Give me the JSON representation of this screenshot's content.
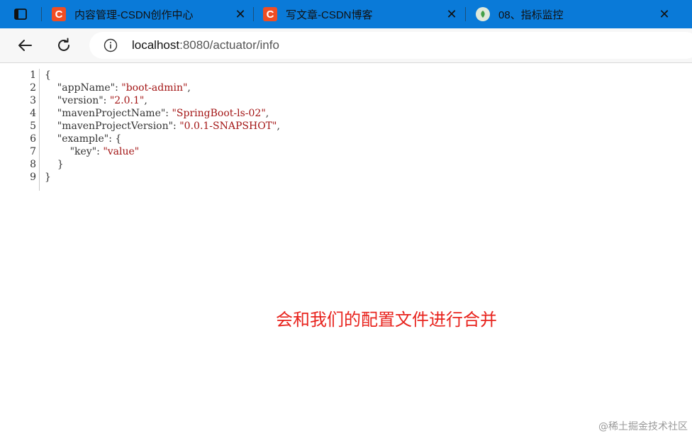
{
  "tabs": [
    {
      "title": "内容管理-CSDN创作中心",
      "icon": "csdn-icon"
    },
    {
      "title": "写文章-CSDN博客",
      "icon": "csdn-icon"
    },
    {
      "title": "08、指标监控",
      "icon": "spring-icon"
    }
  ],
  "toolbar": {
    "url_host": "localhost",
    "url_rest": ":8080/actuator/info"
  },
  "json_viewer": {
    "line_numbers": [
      "1",
      "2",
      "3",
      "4",
      "5",
      "6",
      "7",
      "8",
      "9"
    ],
    "lines": [
      {
        "parts": [
          {
            "t": "{",
            "c": "k"
          }
        ]
      },
      {
        "parts": [
          {
            "t": "    \"appName\": ",
            "c": "k"
          },
          {
            "t": "\"boot-admin\"",
            "c": "s"
          },
          {
            "t": ",",
            "c": "k"
          }
        ]
      },
      {
        "parts": [
          {
            "t": "    \"version\": ",
            "c": "k"
          },
          {
            "t": "\"2.0.1\"",
            "c": "s"
          },
          {
            "t": ",",
            "c": "k"
          }
        ]
      },
      {
        "parts": [
          {
            "t": "    \"mavenProjectName\": ",
            "c": "k"
          },
          {
            "t": "\"SpringBoot-ls-02\"",
            "c": "s"
          },
          {
            "t": ",",
            "c": "k"
          }
        ]
      },
      {
        "parts": [
          {
            "t": "    \"mavenProjectVersion\": ",
            "c": "k"
          },
          {
            "t": "\"0.0.1-SNAPSHOT\"",
            "c": "s"
          },
          {
            "t": ",",
            "c": "k"
          }
        ]
      },
      {
        "parts": [
          {
            "t": "    \"example\": {",
            "c": "k"
          }
        ]
      },
      {
        "parts": [
          {
            "t": "        \"key\": ",
            "c": "k"
          },
          {
            "t": "\"value\"",
            "c": "s"
          }
        ]
      },
      {
        "parts": [
          {
            "t": "    }",
            "c": "k"
          }
        ]
      },
      {
        "parts": [
          {
            "t": "}",
            "c": "k"
          }
        ]
      }
    ]
  },
  "annotation": "会和我们的配置文件进行合并",
  "watermark": "@稀土掘金技术社区",
  "colors": {
    "tabstrip": "#0a7ad8",
    "annotation": "#e8231d",
    "string": "#a31515"
  }
}
